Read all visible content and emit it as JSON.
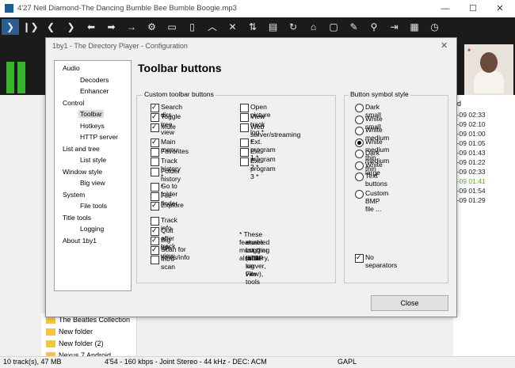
{
  "window": {
    "title": "4'27 Neil Diamond-The Dancing Bumble Bee Bumble Boogie.mp3"
  },
  "toolbar_icons": [
    "play-icon",
    "play-pause-icon",
    "previous-icon",
    "next-icon",
    "back-icon",
    "forward-icon",
    "arrow-right-icon",
    "gear-icon",
    "window-icon",
    "panel-icon",
    "up-icon",
    "close-icon",
    "sort-icon",
    "box-icon",
    "repeat-icon",
    "home-icon",
    "monitor-icon",
    "pencil-icon",
    "search-icon",
    "export-icon",
    "list-icon",
    "clock-icon"
  ],
  "right_list": {
    "header": "ed",
    "rows": [
      {
        "text": "4-09 02:33",
        "color": "#222222"
      },
      {
        "text": "4-09 02:10",
        "color": "#222222"
      },
      {
        "text": "4-09 01:00",
        "color": "#222222"
      },
      {
        "text": "4-09 01:05",
        "color": "#222222"
      },
      {
        "text": "4-09 01:43",
        "color": "#222222"
      },
      {
        "text": "4-09 01:22",
        "color": "#222222"
      },
      {
        "text": "4-09 02:33",
        "color": "#222222"
      },
      {
        "text": "4-09 01:41",
        "color": "#5aa81e"
      },
      {
        "text": "4-09 01:54",
        "color": "#222222"
      },
      {
        "text": "4-09 01:29",
        "color": "#222222"
      }
    ]
  },
  "left_tree": [
    "The Beatles Collection",
    "New folder",
    "New folder (2)",
    "Nexus 7 Android"
  ],
  "status": {
    "tracks": "10 track(s), 47 MB",
    "info": "4'54 - 160 kbps - Joint Stereo - 44 kHz - DEC: ACM",
    "gapl": "GAPL"
  },
  "dialog": {
    "title": "1by1 - The Directory Player - Configuration",
    "heading": "Toolbar buttons",
    "close_button": "Close",
    "nav": [
      {
        "label": "Audio",
        "level": 0
      },
      {
        "label": "Decoders",
        "level": 1
      },
      {
        "label": "Enhancer",
        "level": 1
      },
      {
        "label": "Control",
        "level": 0
      },
      {
        "label": "Toolbar",
        "level": 1,
        "selected": true
      },
      {
        "label": "Hotkeys",
        "level": 1
      },
      {
        "label": "HTTP server",
        "level": 1
      },
      {
        "label": "List and tree",
        "level": 0
      },
      {
        "label": "List style",
        "level": 1
      },
      {
        "label": "Window style",
        "level": 0
      },
      {
        "label": "Big view",
        "level": 1
      },
      {
        "label": "System",
        "level": 0
      },
      {
        "label": "File tools",
        "level": 1
      },
      {
        "label": "Title tools",
        "level": 0
      },
      {
        "label": "Logging",
        "level": 1
      },
      {
        "label": "About 1by1",
        "level": 0
      }
    ],
    "custom_group_label": "Custom toolbar buttons",
    "col1": [
      {
        "label": "Search dirs",
        "checked": true
      },
      {
        "label": "Toggle tree view",
        "checked": true
      },
      {
        "label": "Mute",
        "checked": true
      },
      {
        "label": "",
        "checked": null
      },
      {
        "label": "Main menu",
        "checked": true
      },
      {
        "label": "Favorites",
        "checked": false
      },
      {
        "label": "Track history *",
        "checked": false
      },
      {
        "label": "Folder history *",
        "checked": false
      },
      {
        "label": "",
        "checked": null
      },
      {
        "label": "Go to folder",
        "checked": false
      },
      {
        "label": "File finder",
        "checked": false
      },
      {
        "label": "Explore",
        "checked": true
      },
      {
        "label": "",
        "checked": null
      },
      {
        "label": "Track info",
        "checked": false
      },
      {
        "label": "Quit after track",
        "checked": true
      },
      {
        "label": "Big title view",
        "checked": true
      },
      {
        "label": "Scan for times/info",
        "checked": true
      },
      {
        "label": "Intro scan",
        "checked": false
      }
    ],
    "col2": [
      {
        "label": "Open picture",
        "checked": false
      },
      {
        "label": "View track log *",
        "checked": false
      },
      {
        "label": "Web server/streaming *",
        "checked": false
      },
      {
        "label": "",
        "checked": null
      },
      {
        "label": "Ext. program 1 *",
        "checked": false
      },
      {
        "label": "Ext. program 2 *",
        "checked": false
      },
      {
        "label": "Ext. program 3 *",
        "checked": false
      }
    ],
    "note": [
      "* These features must also be",
      "enabled in other tabs:",
      "Logging (history, log view),",
      "HTTP server, File tools"
    ],
    "style_group_label": "Button symbol style",
    "styles": [
      {
        "label": "Dark small",
        "checked": false
      },
      {
        "label": "White small",
        "checked": false
      },
      {
        "label": "White medium",
        "checked": false
      },
      {
        "label": "White medium thin",
        "checked": true
      },
      {
        "label": "Dark medium thin",
        "checked": false
      },
      {
        "label": "White large",
        "checked": false
      },
      {
        "label": "Text buttons",
        "checked": false
      },
      {
        "label": "",
        "checked": null
      },
      {
        "label": "Custom BMP file ...",
        "checked": false
      }
    ],
    "no_separators": {
      "label": "No separators",
      "checked": true
    }
  }
}
